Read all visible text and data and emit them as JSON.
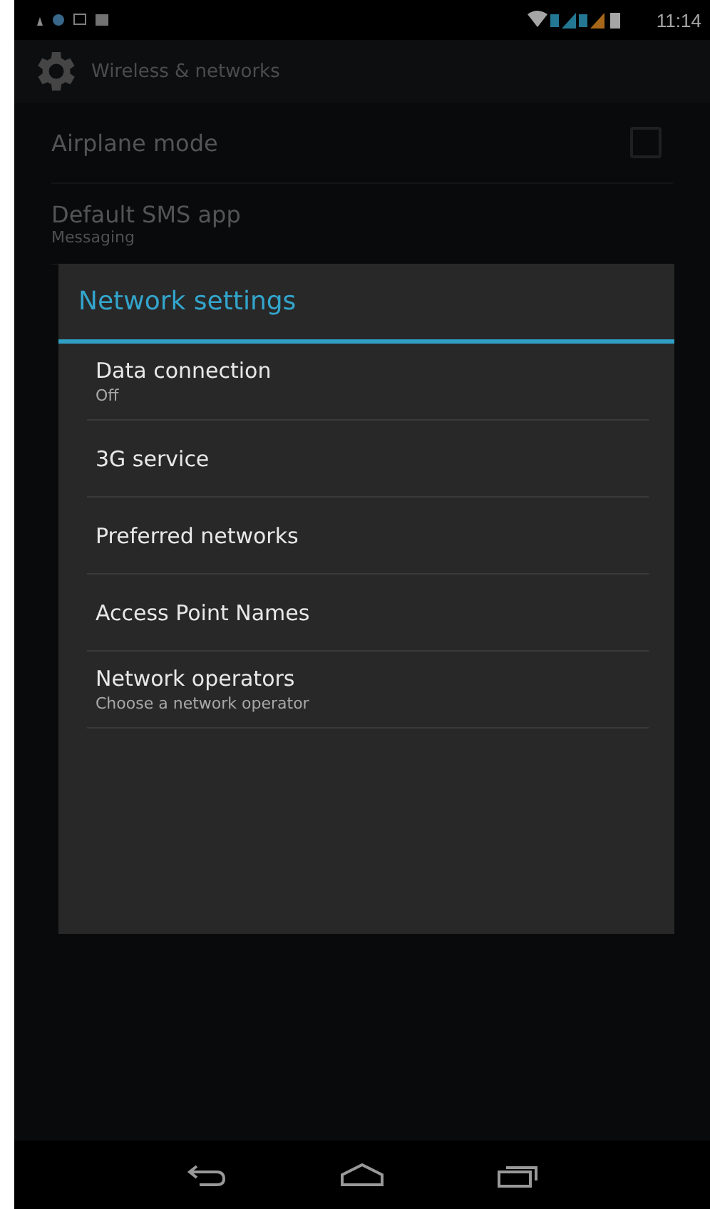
{
  "status_bar": {
    "time": "11:14"
  },
  "action_bar": {
    "title": "Wireless & networks"
  },
  "settings": [
    {
      "kind": "toggle",
      "title": "Airplane mode",
      "checked": false
    },
    {
      "kind": "plain",
      "title": "Default SMS app",
      "summary": "Messaging"
    }
  ],
  "dialog": {
    "title": "Network settings",
    "items": [
      {
        "title": "Data connection",
        "summary": "Off"
      },
      {
        "title": "3G service"
      },
      {
        "title": "Preferred networks"
      },
      {
        "title": "Access Point Names"
      },
      {
        "title": "Network operators",
        "summary": "Choose a network operator"
      }
    ]
  }
}
